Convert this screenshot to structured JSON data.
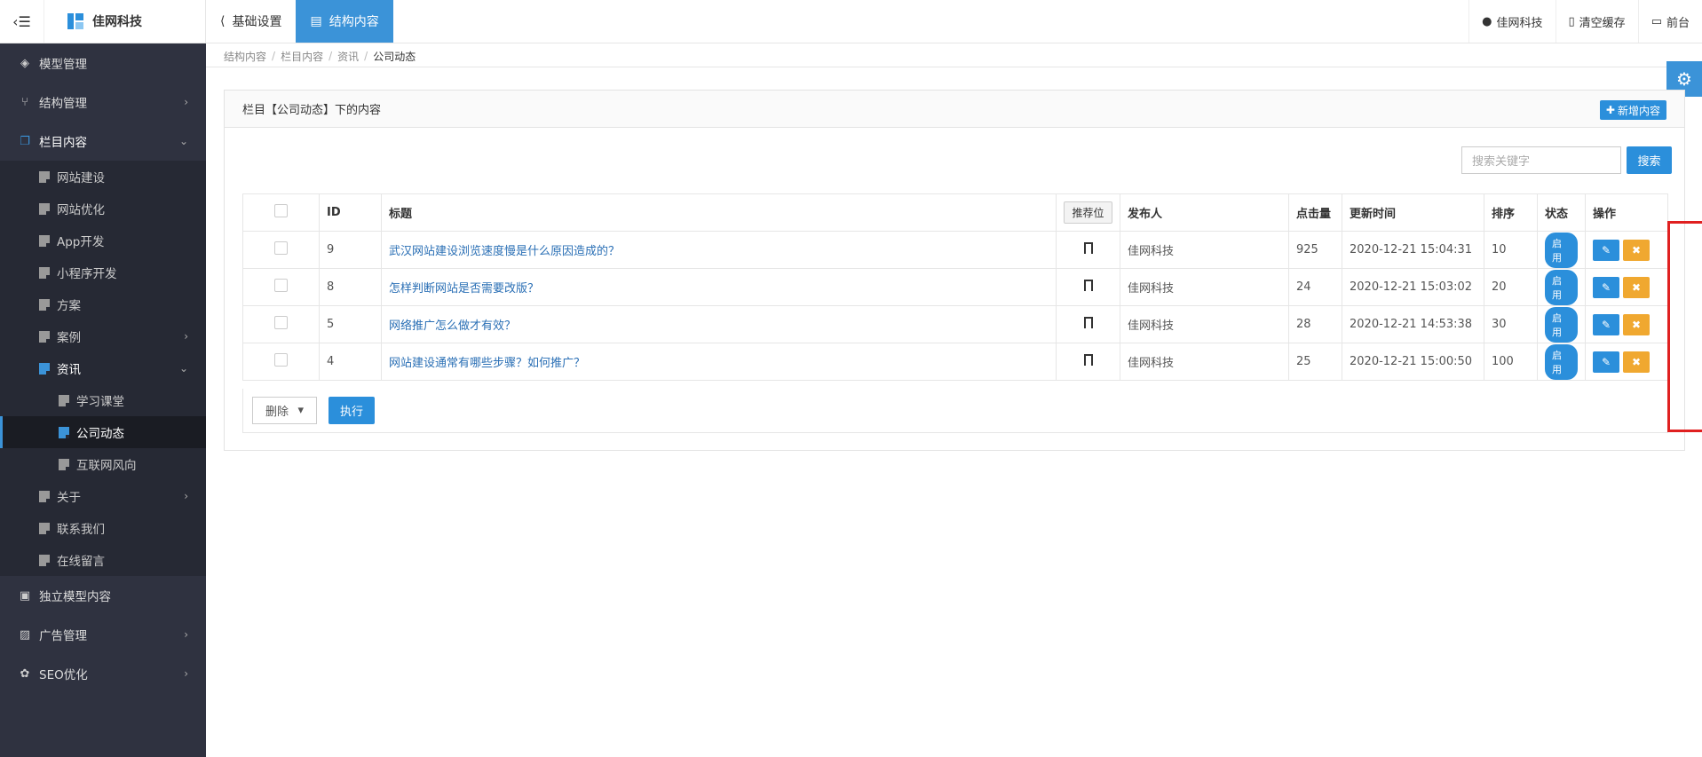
{
  "header": {
    "logo_text": "佳网科技",
    "top_nav": [
      {
        "label": "基础设置",
        "icon": "share-icon"
      },
      {
        "label": "结构内容",
        "icon": "document-icon"
      }
    ],
    "right": [
      {
        "label": "佳网科技",
        "icon": "user-icon"
      },
      {
        "label": "清空缓存",
        "icon": "trash-icon"
      },
      {
        "label": "前台",
        "icon": "laptop-icon"
      }
    ]
  },
  "sidebar": {
    "items": [
      {
        "label": "模型管理",
        "icon": "cube-icon"
      },
      {
        "label": "结构管理",
        "icon": "branch-icon",
        "arrow": "›"
      },
      {
        "label": "栏目内容",
        "icon": "copy-icon",
        "arrow": "⌄"
      }
    ],
    "sub": [
      {
        "label": "网站建设"
      },
      {
        "label": "网站优化"
      },
      {
        "label": "App开发"
      },
      {
        "label": "小程序开发"
      },
      {
        "label": "方案"
      },
      {
        "label": "案例",
        "arrow": "›"
      },
      {
        "label": "资讯",
        "arrow": "⌄"
      }
    ],
    "sub2": [
      {
        "label": "学习课堂"
      },
      {
        "label": "公司动态"
      },
      {
        "label": "互联网风向"
      }
    ],
    "sub_after": [
      {
        "label": "关于",
        "arrow": "›"
      },
      {
        "label": "联系我们"
      },
      {
        "label": "在线留言"
      }
    ],
    "bottom": [
      {
        "label": "独立模型内容",
        "icon": "briefcase-icon"
      },
      {
        "label": "广告管理",
        "icon": "image-icon",
        "arrow": "›"
      },
      {
        "label": "SEO优化",
        "icon": "paw-icon",
        "arrow": "›"
      }
    ]
  },
  "breadcrumb": [
    "结构内容",
    "栏目内容",
    "资讯",
    "公司动态"
  ],
  "panel": {
    "title": "栏目【公司动态】下的内容",
    "add_label": "新增内容",
    "search_placeholder": "搜索关键字",
    "search_label": "搜索"
  },
  "table": {
    "headers": {
      "id": "ID",
      "title": "标题",
      "recommend": "推荐位",
      "publisher": "发布人",
      "clicks": "点击量",
      "updated": "更新时间",
      "sort": "排序",
      "status": "状态",
      "ops": "操作"
    },
    "rows": [
      {
        "id": "9",
        "title": "武汉网站建设浏览速度慢是什么原因造成的？",
        "publisher": "佳网科技",
        "clicks": "925",
        "updated": "2020-12-21 15:04:31",
        "sort": "10",
        "status": "启用"
      },
      {
        "id": "8",
        "title": "怎样判断网站是否需要改版？",
        "publisher": "佳网科技",
        "clicks": "24",
        "updated": "2020-12-21 15:03:02",
        "sort": "20",
        "status": "启用"
      },
      {
        "id": "5",
        "title": "网络推广怎么做才有效？",
        "publisher": "佳网科技",
        "clicks": "28",
        "updated": "2020-12-21 14:53:38",
        "sort": "30",
        "status": "启用"
      },
      {
        "id": "4",
        "title": "网站建设通常有哪些步骤？如何推广？",
        "publisher": "佳网科技",
        "clicks": "25",
        "updated": "2020-12-21 15:00:50",
        "sort": "100",
        "status": "启用"
      }
    ]
  },
  "bulk": {
    "action": "删除",
    "exec_label": "执行"
  },
  "colors": {
    "accent": "#2b8fdb",
    "sidebar": "#2f3240",
    "highlight": "#e02020",
    "delete": "#f0a830"
  }
}
